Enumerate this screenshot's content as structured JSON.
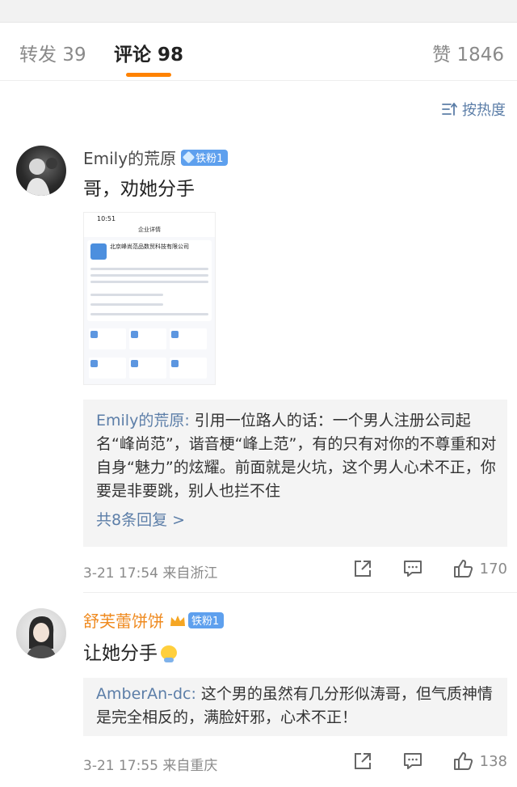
{
  "tabs": {
    "repost": "转发 39",
    "comment": "评论 98",
    "like": "赞 1846"
  },
  "sort_label": "按热度",
  "comments": [
    {
      "username": "Emily的荒原",
      "badge": "铁粉1",
      "text": "哥，劝她分手",
      "image": {
        "time": "10:51",
        "title": "企业详情",
        "company": "北京峰尚范品数贸科技有限公司"
      },
      "reply_author": "Emily的荒原:",
      "reply_text": " 引用一位路人的话：一个男人注册公司起名“峰尚范”，谐音梗“峰上范”，有的只有对你的不尊重和对自身“魅力”的炫耀。前面就是火坑，这个男人心术不正，你要是非要跳，别人也拦不住",
      "more_replies": "共8条回复 >",
      "time_location": "3-21 17:54  来自浙江",
      "likes": "170"
    },
    {
      "username": "舒芙蕾饼饼",
      "badge": "铁粉1",
      "text": "让她分手",
      "reply_author": "AmberAn-dc:",
      "reply_text": " 这个男的虽然有几分形似涛哥，但气质神情是完全相反的，满脸奸邪，心术不正！",
      "time_location": "3-21 17:55  来自重庆",
      "likes": "138"
    }
  ],
  "colors": {
    "accent": "#ff8200",
    "link": "#5c7ea8",
    "badge": "#5ea0ee",
    "vip_name": "#ef8a1f"
  }
}
